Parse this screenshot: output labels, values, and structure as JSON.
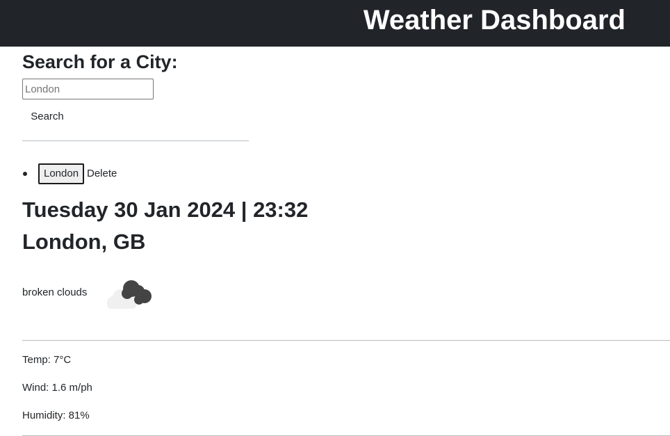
{
  "header": {
    "title": "Weather Dashboard"
  },
  "search": {
    "heading": "Search for a City:",
    "input_value": "",
    "placeholder": "London",
    "button_label": "Search"
  },
  "history": {
    "items": [
      {
        "city": "London",
        "delete_label": "Delete"
      }
    ]
  },
  "current": {
    "datetime": "Tuesday 30 Jan 2024 | 23:32",
    "location": "London, GB",
    "description": "broken clouds",
    "icon": "broken-clouds-icon",
    "temp": "Temp: 7°C",
    "wind": "Wind: 1.6 m/ph",
    "humidity": "Humidity: 81%"
  },
  "colors": {
    "header_bg": "#212529",
    "header_text": "#ffffff",
    "body_text": "#212529",
    "divider": "#b8bcc0"
  }
}
